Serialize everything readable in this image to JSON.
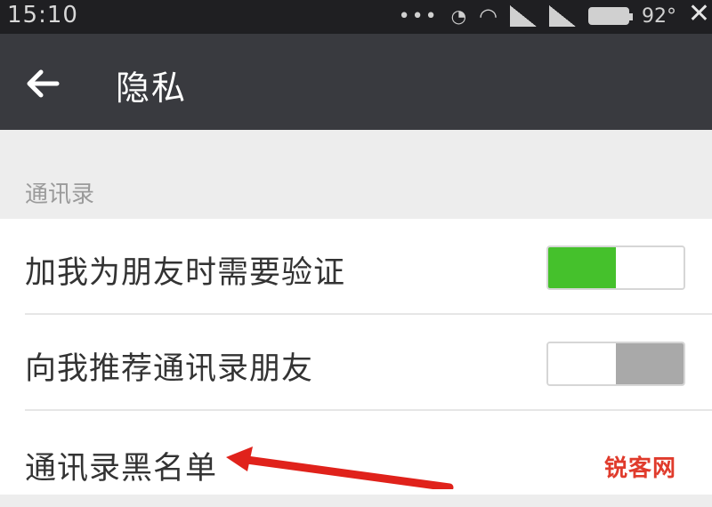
{
  "status_bar": {
    "time": "15:10",
    "battery": "92°",
    "icons": [
      "more-dots-icon",
      "alarm-icon",
      "wifi-icon",
      "signal-icon",
      "signal-icon",
      "battery-icon"
    ]
  },
  "toolbar": {
    "title": "隐私",
    "back_icon": "back-arrow-icon"
  },
  "section": {
    "header": "通讯录"
  },
  "settings": [
    {
      "label": "加我为朋友时需要验证",
      "toggle": true
    },
    {
      "label": "向我推荐通讯录朋友",
      "toggle": false
    },
    {
      "label": "通讯录黑名单"
    }
  ],
  "colors": {
    "toolbar_bg": "#393a3f",
    "status_bg": "#1f1f22",
    "toggle_on": "#45c12c",
    "toggle_off": "#a9a9a9",
    "annotation": "#e0221b"
  },
  "watermark": "锐客网"
}
